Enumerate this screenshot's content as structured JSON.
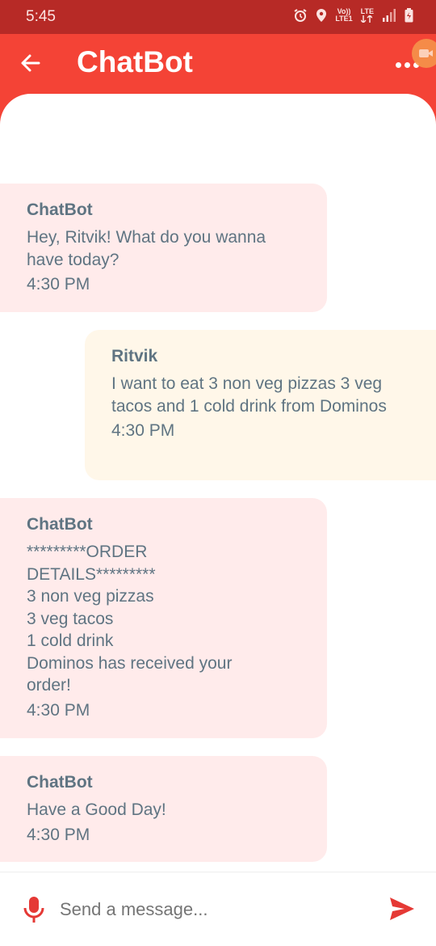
{
  "status_bar": {
    "time": "5:45",
    "network_label_top": "Vo))",
    "network_label_bottom": "LTE1",
    "lte_top": "LTE",
    "icons": [
      "alarm-icon",
      "location-icon",
      "volte-icon",
      "lte-icon",
      "signal-icon",
      "battery-icon"
    ]
  },
  "app_bar": {
    "title": "ChatBot",
    "back_icon": "arrow-left-icon",
    "more_icon": "more-horizontal-icon"
  },
  "messages": [
    {
      "type": "bot",
      "sender": "ChatBot",
      "text": "Hey, Ritvik! What do you wanna have today?",
      "time": "4:30 PM"
    },
    {
      "type": "user",
      "sender": "Ritvik",
      "text": "I want to eat 3 non veg pizzas 3 veg tacos and 1 cold drink from Dominos",
      "time": "4:30 PM"
    },
    {
      "type": "bot",
      "sender": "ChatBot",
      "text": "*********ORDER\nDETAILS*********\n3 non veg pizzas\n3 veg tacos\n1 cold drink\nDominos has received your\norder!",
      "time": "4:30 PM"
    },
    {
      "type": "bot",
      "sender": "ChatBot",
      "text": "Have a Good Day!",
      "time": "4:30 PM"
    }
  ],
  "input": {
    "placeholder": "Send a message...",
    "value": "",
    "mic_icon": "microphone-icon",
    "send_icon": "send-icon"
  },
  "colors": {
    "primary": "#f44336",
    "status_bar": "#b72a26",
    "bot_bubble": "#ffebeb",
    "user_bubble": "#fff7e9",
    "message_text": "#5f7482",
    "accent_red": "#e53935"
  }
}
